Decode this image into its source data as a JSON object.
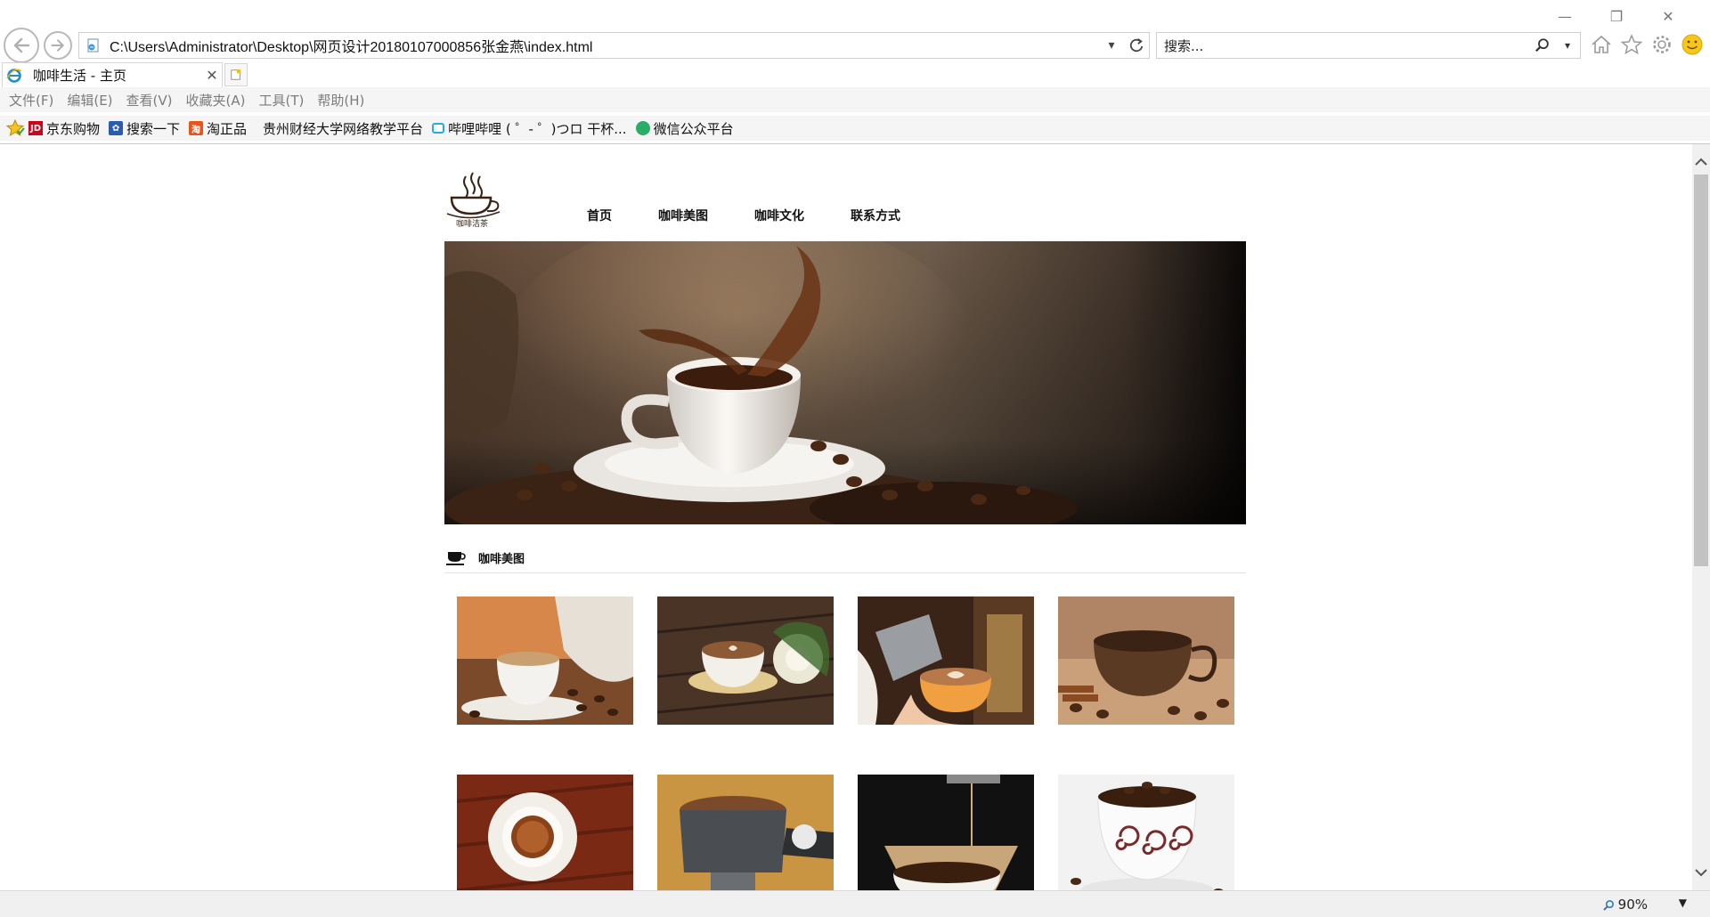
{
  "browser": {
    "address": "C:\\Users\\Administrator\\Desktop\\网页设计20180107000856张金燕\\index.html",
    "search_placeholder": "搜索...",
    "tab_title": "咖啡生活 - 主页",
    "menu": [
      "文件(F)",
      "编辑(E)",
      "查看(V)",
      "收藏夹(A)",
      "工具(T)",
      "帮助(H)"
    ],
    "favorites": [
      {
        "label": "京东购物",
        "icon": "jd-icon",
        "color": "#d0021b"
      },
      {
        "label": "搜索一下",
        "icon": "baidu-icon",
        "color": "#2a5db0"
      },
      {
        "label": "淘正品",
        "icon": "taobao-icon",
        "color": "#e8541b"
      },
      {
        "label": "贵州财经大学网络教学平台",
        "icon": "blank-icon",
        "color": "#ffffff"
      },
      {
        "label": "哔哩哔哩 ( ゜- ゜)つロ 干杯...",
        "icon": "bilibili-icon",
        "color": "#23ade5"
      },
      {
        "label": "微信公众平台",
        "icon": "wechat-icon",
        "color": "#2aae67"
      }
    ],
    "zoom": "90%"
  },
  "site": {
    "logo_text": "咖啡洁茶",
    "nav": [
      "首页",
      "咖啡美图",
      "咖啡文化",
      "联系方式"
    ],
    "section_title": "咖啡美图"
  },
  "colors": {
    "coffee": "#3a2417",
    "accent": "#6b3f22"
  }
}
